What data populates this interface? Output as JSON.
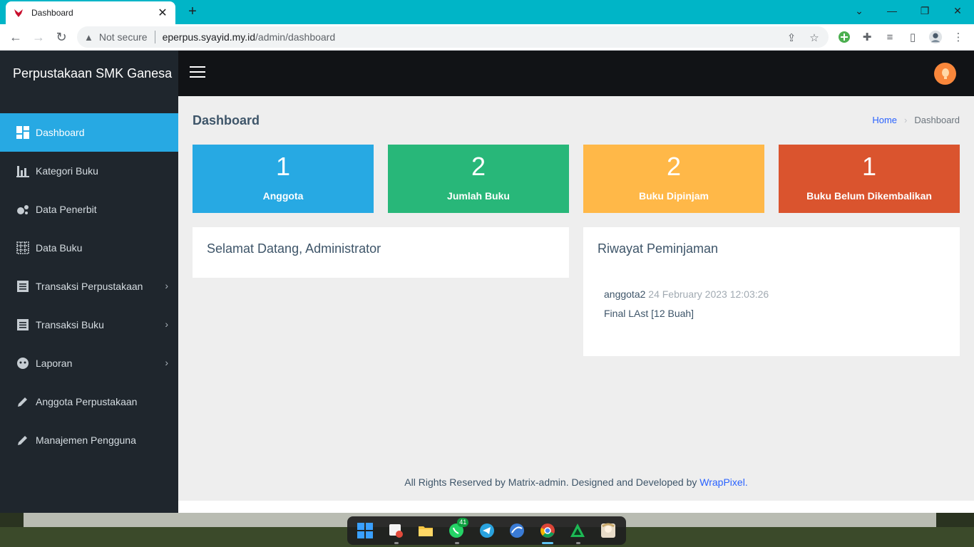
{
  "browser": {
    "tab_title": "Dashboard",
    "new_tab_glyph": "+",
    "security_label": "Not secure",
    "url_host": "eperpus.syayid.my.id",
    "url_path": "/admin/dashboard"
  },
  "app": {
    "brand": "Perpustakaan SMK Ganesa",
    "page_title": "Dashboard",
    "breadcrumb": {
      "home": "Home",
      "current": "Dashboard"
    }
  },
  "sidebar": {
    "items": [
      {
        "label": "Dashboard",
        "icon": "dashboard-icon",
        "active": true
      },
      {
        "label": "Kategori Buku",
        "icon": "bar-chart-icon"
      },
      {
        "label": "Data Penerbit",
        "icon": "bubbles-icon"
      },
      {
        "label": "Data Buku",
        "icon": "grid-icon"
      },
      {
        "label": "Transaksi Perpustakaan",
        "icon": "list-icon",
        "has_submenu": true
      },
      {
        "label": "Transaksi Buku",
        "icon": "list-icon",
        "has_submenu": true
      },
      {
        "label": "Laporan",
        "icon": "face-icon",
        "has_submenu": true
      },
      {
        "label": "Anggota Perpustakaan",
        "icon": "pencil-icon"
      },
      {
        "label": "Manajemen Pengguna",
        "icon": "pencil-icon"
      }
    ]
  },
  "stats": [
    {
      "value": "1",
      "label": "Anggota",
      "color": "#27a9e3"
    },
    {
      "value": "2",
      "label": "Jumlah Buku",
      "color": "#28b779"
    },
    {
      "value": "2",
      "label": "Buku Dipinjam",
      "color": "#ffb848"
    },
    {
      "value": "1",
      "label": "Buku Belum Dikembalikan",
      "color": "#da542e"
    }
  ],
  "welcome": {
    "title": "Selamat Datang, Administrator"
  },
  "history": {
    "title": "Riwayat Peminjaman",
    "user": "anggota2",
    "timestamp": "24 February 2023 12:03:26",
    "item": "Final LAst [12 Buah]"
  },
  "footer": {
    "text": "All Rights Reserved by Matrix-admin. Designed and Developed by",
    "link": "WrapPixel",
    "end": "."
  },
  "taskbar": {
    "whatsapp_badge": "41"
  }
}
